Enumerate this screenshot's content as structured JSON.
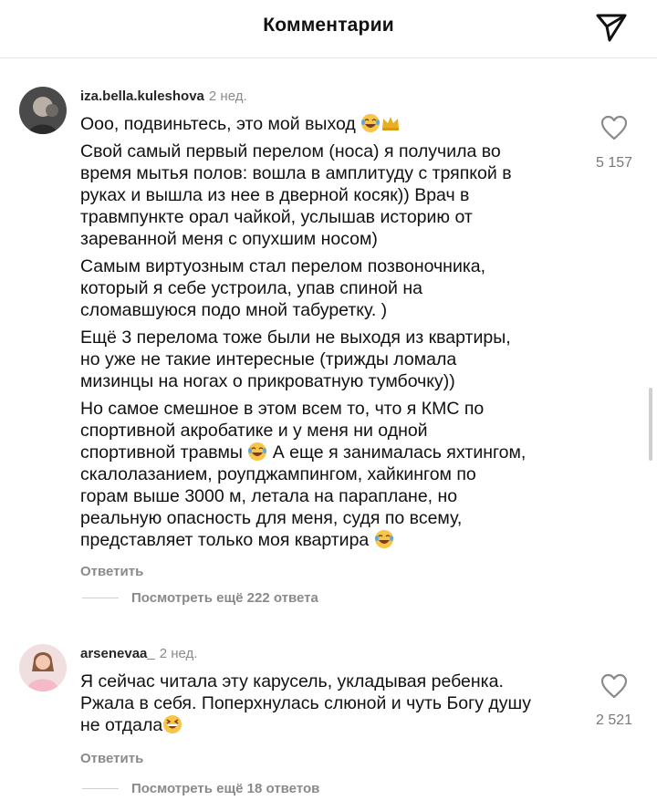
{
  "header": {
    "title": "Комментарии",
    "share_icon": "paper-plane-icon"
  },
  "comments": [
    {
      "username": "iza.bella.kuleshova",
      "time": "2 нед.",
      "paragraphs": [
        "Ооо, подвиньтесь, это мой выход",
        "Свой самый первый перелом (носа) я получила во\nвремя мытья полов: вошла в амплитуду с тряпкой в\nруках и вышла из нее в дверной косяк)) Врач в\nтравмпункте орал чайкой, услышав историю от\nзареванной меня с опухшим носом)",
        "Самым виртуозным стал перелом позвоночника,\nкоторый я себе устроила, упав спиной на\nсломавшуюся подо мной табуретку. )",
        "Ещё 3 перелома тоже были не выходя из квартиры,\nно уже не такие интересные (трижды ломала\nмизинцы на ногах о прикроватную тумбочку))",
        "Но самое смешное в этом всем то, что я КМС по\nспортивной акробатике и у меня ни одной\nспортивной травмы",
        " А еще я занималась яхтингом,\nскалолазанием, роупджампингом, хайкингом по\nгорам выше 3000 м, летала на параплане, но\nреальную опасность для меня, судя по всему,\nпредставляет только моя квартира"
      ],
      "emojis": [
        "face-with-tears-of-joy",
        "crown",
        "face-with-tears-of-joy",
        "face-with-tears-of-joy"
      ],
      "reply_label": "Ответить",
      "more_replies": "Посмотреть ещё 222 ответа",
      "likes": "5 157"
    },
    {
      "username": "arsenevaa_",
      "time": "2 нед.",
      "text": "Я сейчас читала эту карусель, укладывая ребенка.\nРжала в себя. Поперхнулась слюной и чуть Богу душу\nне отдала",
      "emojis": [
        "grinning-squinting-face"
      ],
      "reply_label": "Ответить",
      "more_replies": "Посмотреть ещё 18 ответов",
      "likes": "2 521"
    }
  ]
}
